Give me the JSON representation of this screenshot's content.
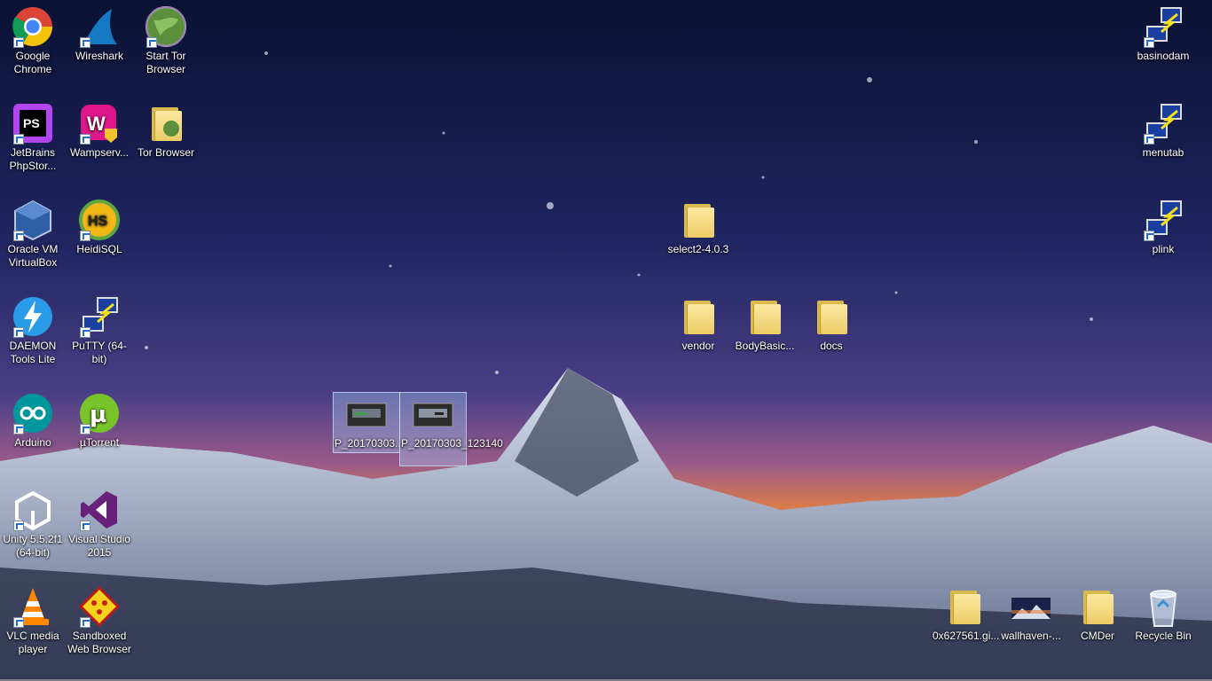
{
  "desktop": {
    "icons": [
      {
        "label": "Google Chrome",
        "icon": "chrome-icon",
        "shortcut": true
      },
      {
        "label": "Wireshark",
        "icon": "wireshark-icon",
        "shortcut": true
      },
      {
        "label": "Start Tor Browser",
        "icon": "tor-globe-icon",
        "shortcut": true
      },
      {
        "label": "JetBrains PhpStor...",
        "icon": "phpstorm-icon",
        "shortcut": true
      },
      {
        "label": "Wampserv...",
        "icon": "wampserver-icon",
        "shortcut": true
      },
      {
        "label": "Tor Browser",
        "icon": "tor-folder-icon",
        "shortcut": false
      },
      {
        "label": "Oracle VM VirtualBox",
        "icon": "virtualbox-icon",
        "shortcut": true
      },
      {
        "label": "HeidiSQL",
        "icon": "heidisql-icon",
        "shortcut": true
      },
      {
        "label": "DAEMON Tools Lite",
        "icon": "daemon-tools-icon",
        "shortcut": true
      },
      {
        "label": "PuTTY (64-bit)",
        "icon": "putty-icon",
        "shortcut": true
      },
      {
        "label": "Arduino",
        "icon": "arduino-icon",
        "shortcut": true
      },
      {
        "label": "µTorrent",
        "icon": "utorrent-icon",
        "shortcut": true
      },
      {
        "label": "Unity 5.5.2f1 (64-bit)",
        "icon": "unity-icon",
        "shortcut": true
      },
      {
        "label": "Visual Studio 2015",
        "icon": "visual-studio-icon",
        "shortcut": true
      },
      {
        "label": "VLC media player",
        "icon": "vlc-icon",
        "shortcut": true
      },
      {
        "label": "Sandboxed Web Browser",
        "icon": "sandboxie-icon",
        "shortcut": true
      },
      {
        "label": "basinodam",
        "icon": "putty-session-icon",
        "shortcut": true
      },
      {
        "label": "menutab",
        "icon": "putty-session-icon",
        "shortcut": true
      },
      {
        "label": "plink",
        "icon": "putty-session-icon",
        "shortcut": true
      },
      {
        "label": "select2-4.0.3",
        "icon": "folder-icon",
        "shortcut": false
      },
      {
        "label": "vendor",
        "icon": "folder-icon",
        "shortcut": false
      },
      {
        "label": "BodyBasic...",
        "icon": "folder-icon",
        "shortcut": false
      },
      {
        "label": "docs",
        "icon": "folder-icon",
        "shortcut": false
      },
      {
        "label": "P_20170303...",
        "icon": "image-file-icon",
        "shortcut": false,
        "selected": true
      },
      {
        "label": "P_20170303_123140",
        "icon": "image-file-icon",
        "shortcut": false,
        "selected": true
      },
      {
        "label": "0x627561.gi...",
        "icon": "folder-icon",
        "shortcut": false
      },
      {
        "label": "wallhaven-...",
        "icon": "image-file-icon",
        "shortcut": false
      },
      {
        "label": "CMDer",
        "icon": "folder-icon",
        "shortcut": false
      },
      {
        "label": "Recycle Bin",
        "icon": "recycle-bin-icon",
        "shortcut": false
      }
    ]
  },
  "colors": {
    "sky_top": "#0a1233",
    "sky_mid": "#3a3f7a",
    "horizon_glow": "#e8823a",
    "snow": "#dfe6f2",
    "selection": "#add8ff"
  }
}
